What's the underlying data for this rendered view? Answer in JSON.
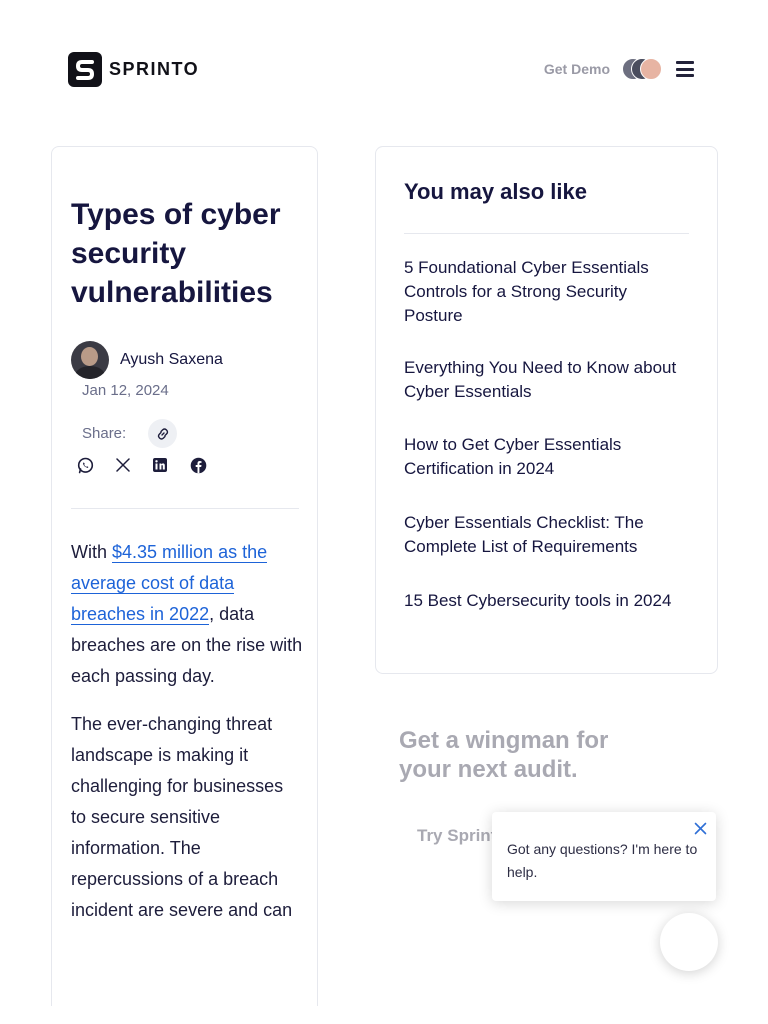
{
  "header": {
    "logo_text": "SPRINTO",
    "get_demo_label": "Get Demo",
    "avatar_icon": "team-avatars-icon",
    "menu_icon": "hamburger-menu-icon"
  },
  "article": {
    "title": "Types of cyber security vulnerabilities",
    "author": "Ayush Saxena",
    "date": "Jan 12, 2024",
    "share_label": "Share:",
    "share_icons": [
      "link-icon",
      "whatsapp-icon",
      "x-icon",
      "linkedin-icon",
      "facebook-icon"
    ],
    "para1_prefix": "With ",
    "para1_link": "$4.35 million as the average cost of data breaches in 2022",
    "para1_suffix": ", data breaches are on the rise with each passing day.",
    "para2": "The ever-changing threat landscape is making it challenging for businesses to secure sensitive information. The repercussions of a breach incident are severe and can"
  },
  "sidebar": {
    "title": "You may also like",
    "items": [
      "5 Foundational Cyber Essentials Controls for a Strong Security Posture",
      "Everything You Need to Know about Cyber Essentials",
      "How to Get Cyber Essentials Certification in 2024",
      "Cyber Essentials Checklist: The Complete List of Requirements",
      "15 Best Cybersecurity tools in 2024"
    ]
  },
  "cta": {
    "title": "Get a wingman for your next audit.",
    "button_label": "Try Sprint"
  },
  "chat": {
    "message": "Got any questions? I'm here to help.",
    "close_icon": "close-icon"
  },
  "colors": {
    "brand_dark": "#111118",
    "heading": "#16163f",
    "link": "#1d63d8",
    "muted": "#9a9aa6"
  }
}
